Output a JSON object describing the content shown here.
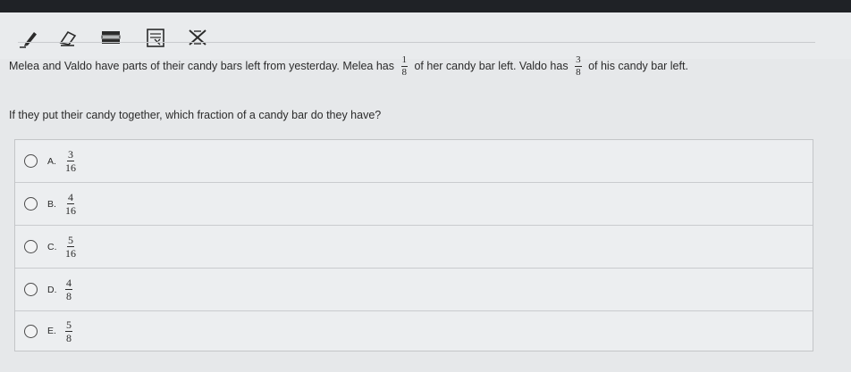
{
  "toolbar": {
    "tools": [
      {
        "icon": "pencil-icon"
      },
      {
        "icon": "eraser-icon"
      },
      {
        "icon": "line-reader-icon"
      },
      {
        "icon": "reference-sheet-icon"
      },
      {
        "icon": "answer-eliminator-icon"
      }
    ]
  },
  "question": {
    "part1": "Melea and Valdo have parts of their candy bars left from yesterday. Melea has",
    "melea_num": "1",
    "melea_den": "8",
    "part2": "of her candy bar left. Valdo has",
    "valdo_num": "3",
    "valdo_den": "8",
    "part3": "of his candy bar left."
  },
  "prompt": "If they put their candy together, which fraction of a candy bar do they have?",
  "choices": [
    {
      "letter": "A.",
      "num": "3",
      "den": "16"
    },
    {
      "letter": "B.",
      "num": "4",
      "den": "16"
    },
    {
      "letter": "C.",
      "num": "5",
      "den": "16"
    },
    {
      "letter": "D.",
      "num": "4",
      "den": "8"
    },
    {
      "letter": "E.",
      "num": "5",
      "den": "8"
    }
  ]
}
